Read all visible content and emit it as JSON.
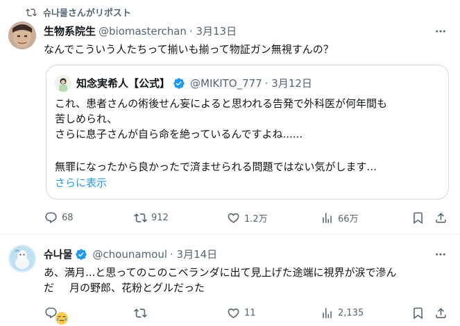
{
  "repost_header": {
    "text": "슈나물さんがリポスト",
    "icon": "repost-icon"
  },
  "tweet1": {
    "author_name": "生物系院生",
    "handle": "@biomasterchan",
    "date": "· 3月13日",
    "text": "なんでこういう人たちって揃いも揃って物証ガン無視すんの？",
    "quote": {
      "author_name": "知念実希人【公式】",
      "handle": "@MIKITO_777",
      "date": "· 3月12日",
      "lines": [
        "これ、患者さんの術後せん妄によると思われる告発で外科医が何年間も",
        "苦しめられ、",
        "さらに息子さんが自ら命を絶っているんですよね......",
        "",
        "無罪になったから良かったで済ませられる問題ではない気がします..."
      ],
      "show_more": "さらに表示"
    },
    "actions": {
      "replies": "68",
      "reposts": "912",
      "likes": "1.2万",
      "views": "66万"
    }
  },
  "tweet2": {
    "author_name": "슈나물",
    "handle": "@chounamoul",
    "date": "· 3月14日",
    "line1": "あ、満月...と思ってのこのこベランダに出て見上げた途端に視界が涙で滲ん",
    "line2_before": "だ",
    "line2_after": "月の野郎、花粉とグルだった",
    "actions": {
      "replies": "",
      "reposts": "",
      "likes": "11",
      "views": "2,135"
    }
  },
  "colors": {
    "accent": "#1d9bf0",
    "muted": "#536471",
    "verified": "#1d9bf0"
  }
}
